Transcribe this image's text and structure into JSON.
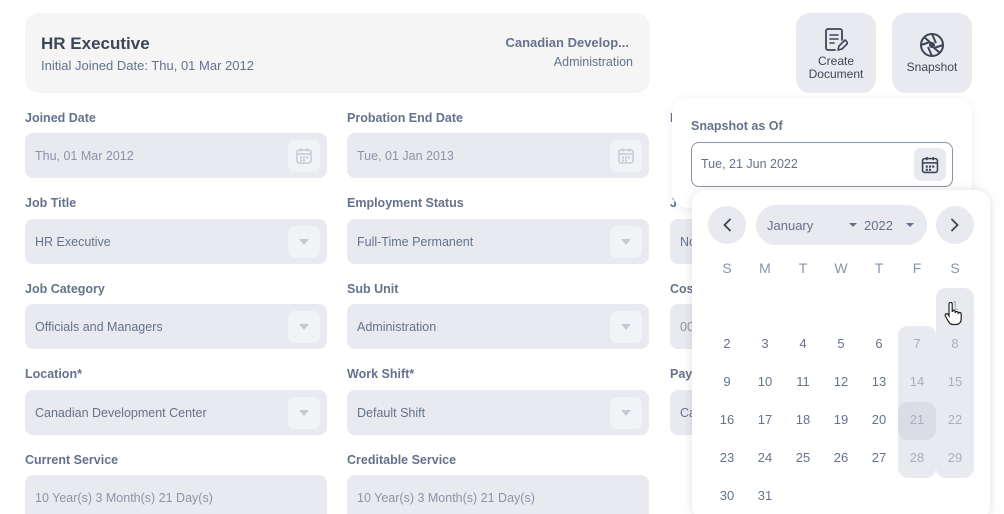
{
  "card": {
    "title": "HR Executive",
    "subtitle": "Initial Joined Date: Thu, 01 Mar 2012",
    "location": "Canadian Develop...",
    "unit": "Administration"
  },
  "actions": {
    "create_document": "Create Document",
    "snapshot": "Snapshot"
  },
  "fields": {
    "joined_date": {
      "label": "Joined Date",
      "value": "Thu, 01 Mar 2012"
    },
    "probation_end_date": {
      "label": "Probation End Date",
      "value": "Tue, 01 Jan 2013"
    },
    "job_title": {
      "label": "Job Title",
      "value": "HR Executive"
    },
    "employment_status": {
      "label": "Employment Status",
      "value": "Full-Time Permanent"
    },
    "job_category": {
      "label": "Job Category",
      "value": "Officials and Managers"
    },
    "sub_unit": {
      "label": "Sub Unit",
      "value": "Administration"
    },
    "location": {
      "label": "Location*",
      "value": "Canadian Development Center"
    },
    "work_shift": {
      "label": "Work Shift*",
      "value": "Default Shift"
    },
    "current_service": {
      "label": "Current Service",
      "value": "10 Year(s) 3 Month(s) 21 Day(s)"
    },
    "creditable_service": {
      "label": "Creditable Service",
      "value": "10 Year(s) 3 Month(s) 21 Day(s)"
    }
  },
  "partial": {
    "row1_label": "I",
    "row2_label": "J",
    "row2_value": "No",
    "row3_label": "Cos",
    "row3_value": "00",
    "row4_label": "Pay",
    "row4_value": "Ca"
  },
  "snapshot": {
    "label": "Snapshot as Of",
    "value": "Tue, 21 Jun 2022"
  },
  "calendar": {
    "month": "January",
    "year": "2022",
    "weekdays": [
      "S",
      "M",
      "T",
      "W",
      "T",
      "F",
      "S"
    ],
    "days": [
      "1",
      "2",
      "3",
      "4",
      "5",
      "6",
      "7",
      "8",
      "9",
      "10",
      "11",
      "12",
      "13",
      "14",
      "15",
      "16",
      "17",
      "18",
      "19",
      "20",
      "21",
      "22",
      "23",
      "24",
      "25",
      "26",
      "27",
      "28",
      "29",
      "30",
      "31"
    ],
    "highlighted_day": "21",
    "first_weekday_index": 6
  },
  "colors": {
    "field_bg": "#e8eaef",
    "text": "#64728c",
    "title": "#3c4658"
  }
}
